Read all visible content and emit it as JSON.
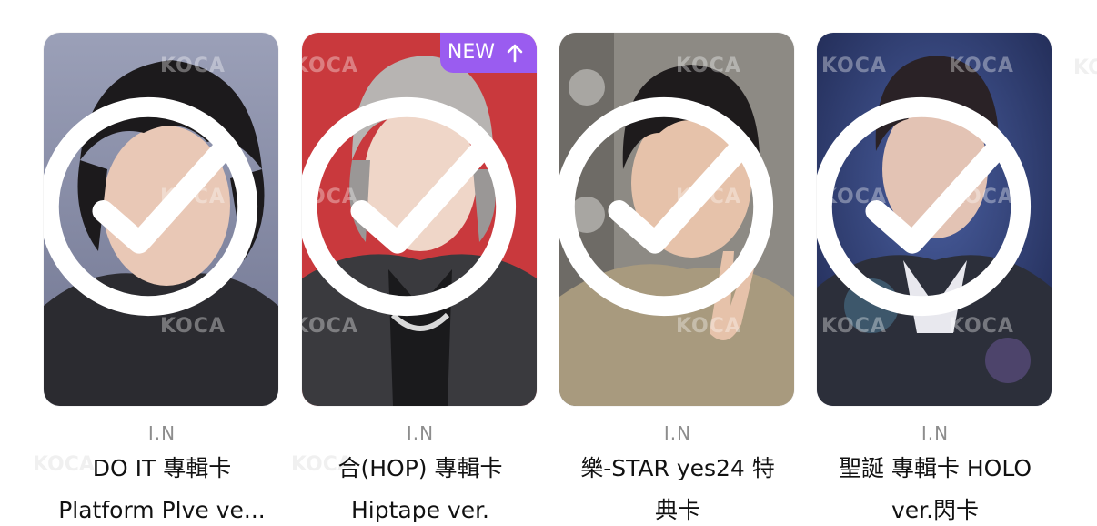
{
  "watermark": "KOCA",
  "new_badge": {
    "label": "NEW"
  },
  "cards": [
    {
      "artist": "I.N",
      "title_line1": "DO IT 專輯卡",
      "title_line2": "Platform Plve ve...",
      "bg_color": "#8a8fa8"
    },
    {
      "artist": "I.N",
      "title_line1": "合(HOP) 專輯卡",
      "title_line2": "Hiptape ver.",
      "bg_color": "#c8383c"
    },
    {
      "artist": "I.N",
      "title_line1": "樂-STAR yes24 特",
      "title_line2": "典卡",
      "bg_color": "#9a8b72"
    },
    {
      "artist": "I.N",
      "title_line1": "聖誕 專輯卡 HOLO",
      "title_line2": "ver.閃卡",
      "bg_color": "#2a3a6a"
    }
  ],
  "colors": {
    "accent": "#9a5cf0",
    "artist_text": "#8d8d8d",
    "title_text": "#111111"
  },
  "icons": {
    "check": "check-circle-icon",
    "arrow": "arrow-up-icon"
  }
}
